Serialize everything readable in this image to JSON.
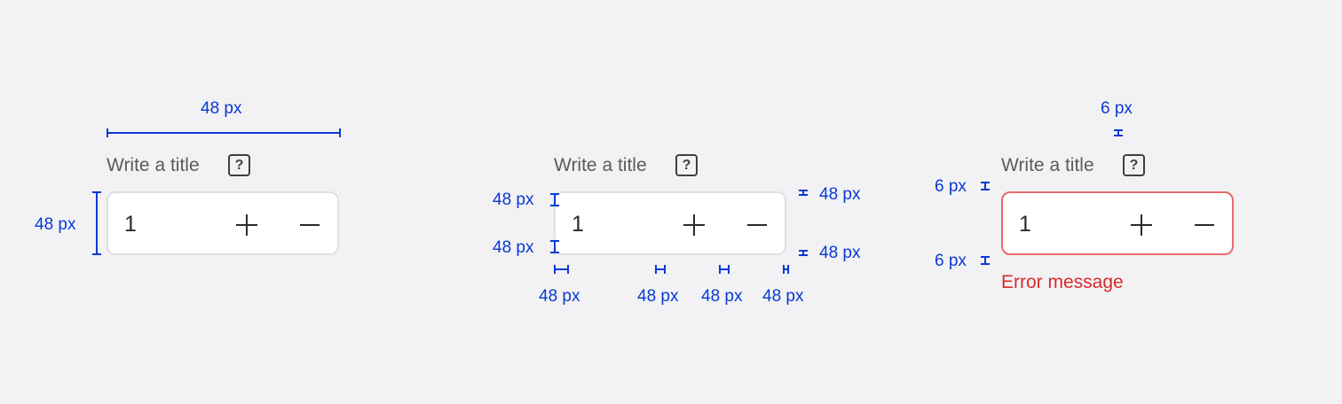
{
  "spec_colors": {
    "annotation": "#0a39d6",
    "error": "#d92b2b",
    "error_border": "#e96b6b"
  },
  "variants": [
    {
      "id": "width-spec",
      "label": "Write a title",
      "help_icon": "?",
      "value": "1",
      "annotations": {
        "width": "48 px",
        "height": "48 px"
      }
    },
    {
      "id": "spacing-spec",
      "label": "Write a title",
      "help_icon": "?",
      "value": "1",
      "annotations": {
        "left_top": "48 px",
        "left_bottom": "48 px",
        "right_top": "48 px",
        "right_bottom": "48 px",
        "bottom_1": "48 px",
        "bottom_2": "48 px",
        "bottom_3": "48 px",
        "bottom_4": "48 px"
      }
    },
    {
      "id": "error-spec",
      "label": "Write a title",
      "help_icon": "?",
      "value": "1",
      "error_message": "Error message",
      "annotations": {
        "top": "6 px",
        "left_top": "6 px",
        "left_bottom": "6 px"
      }
    }
  ]
}
